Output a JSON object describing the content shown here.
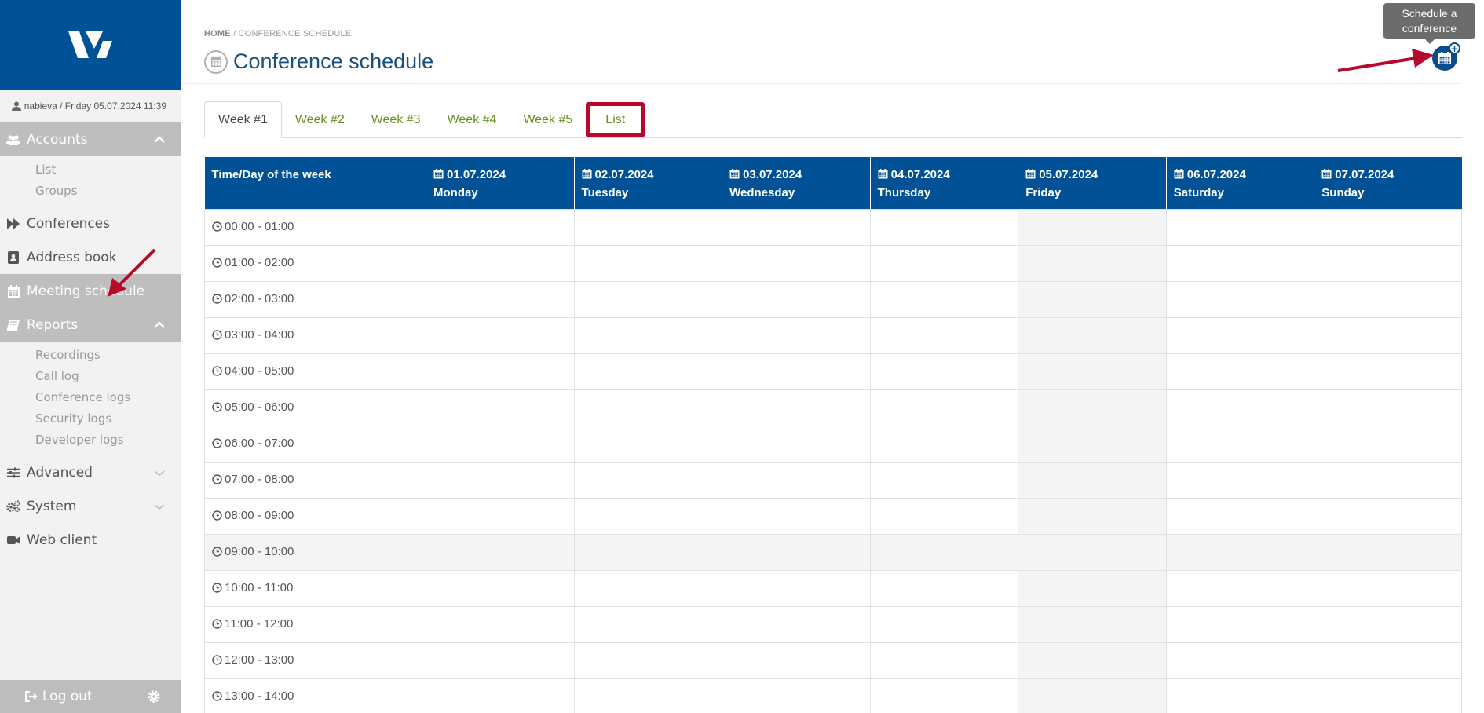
{
  "user": {
    "info": "nabieva / Friday 05.07.2024 11:39"
  },
  "sidebar": {
    "accounts": {
      "label": "Accounts",
      "items": [
        "List",
        "Groups"
      ]
    },
    "conferences": "Conferences",
    "address_book": "Address book",
    "meeting_schedule": "Meeting schedule",
    "reports": {
      "label": "Reports",
      "items": [
        "Recordings",
        "Call log",
        "Conference logs",
        "Security logs",
        "Developer logs"
      ]
    },
    "advanced": "Advanced",
    "system": "System",
    "web_client": "Web client",
    "logout": "Log out"
  },
  "breadcrumb": {
    "home": "HOME",
    "current": "/ CONFERENCE SCHEDULE"
  },
  "page": {
    "title": "Conference schedule"
  },
  "tooltip": {
    "text": "Schedule a conference"
  },
  "tabs": [
    "Week #1",
    "Week #2",
    "Week #3",
    "Week #4",
    "Week #5",
    "List"
  ],
  "table": {
    "corner": "Time/Day of the week",
    "days": [
      {
        "date": "01.07.2024",
        "day": "Monday"
      },
      {
        "date": "02.07.2024",
        "day": "Tuesday"
      },
      {
        "date": "03.07.2024",
        "day": "Wednesday"
      },
      {
        "date": "04.07.2024",
        "day": "Thursday"
      },
      {
        "date": "05.07.2024",
        "day": "Friday"
      },
      {
        "date": "06.07.2024",
        "day": "Saturday"
      },
      {
        "date": "07.07.2024",
        "day": "Sunday"
      }
    ],
    "times": [
      "00:00 - 01:00",
      "01:00 - 02:00",
      "02:00 - 03:00",
      "03:00 - 04:00",
      "04:00 - 05:00",
      "05:00 - 06:00",
      "06:00 - 07:00",
      "07:00 - 08:00",
      "08:00 - 09:00",
      "09:00 - 10:00",
      "10:00 - 11:00",
      "11:00 - 12:00",
      "12:00 - 13:00",
      "13:00 - 14:00"
    ]
  },
  "colors": {
    "brand": "#005196",
    "highlight": "#b7092b",
    "tab_link": "#6b8e23",
    "title": "#1b4f7c"
  }
}
